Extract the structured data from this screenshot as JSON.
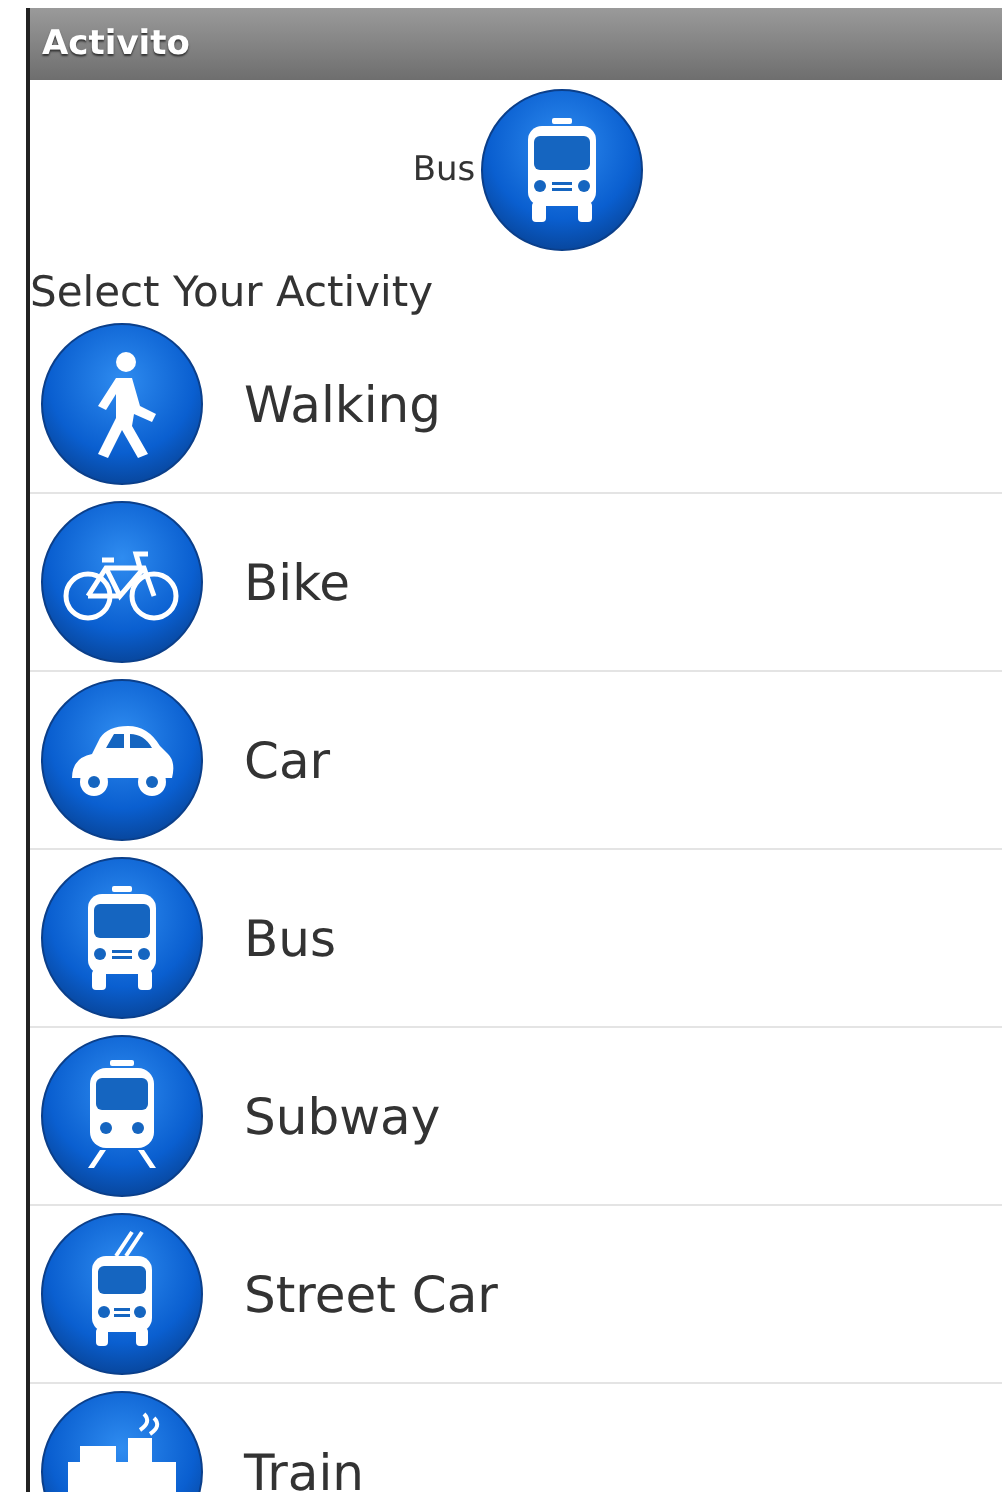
{
  "window": {
    "title": "Activito"
  },
  "current_activity": {
    "label": "Bus",
    "kind": "bus"
  },
  "prompt": "Select Your Activity",
  "activities": [
    {
      "label": "Walking",
      "kind": "walk"
    },
    {
      "label": "Bike",
      "kind": "bike"
    },
    {
      "label": "Car",
      "kind": "car"
    },
    {
      "label": "Bus",
      "kind": "bus"
    },
    {
      "label": "Subway",
      "kind": "subway"
    },
    {
      "label": "Street Car",
      "kind": "streetcar"
    },
    {
      "label": "Train",
      "kind": "train"
    }
  ]
}
